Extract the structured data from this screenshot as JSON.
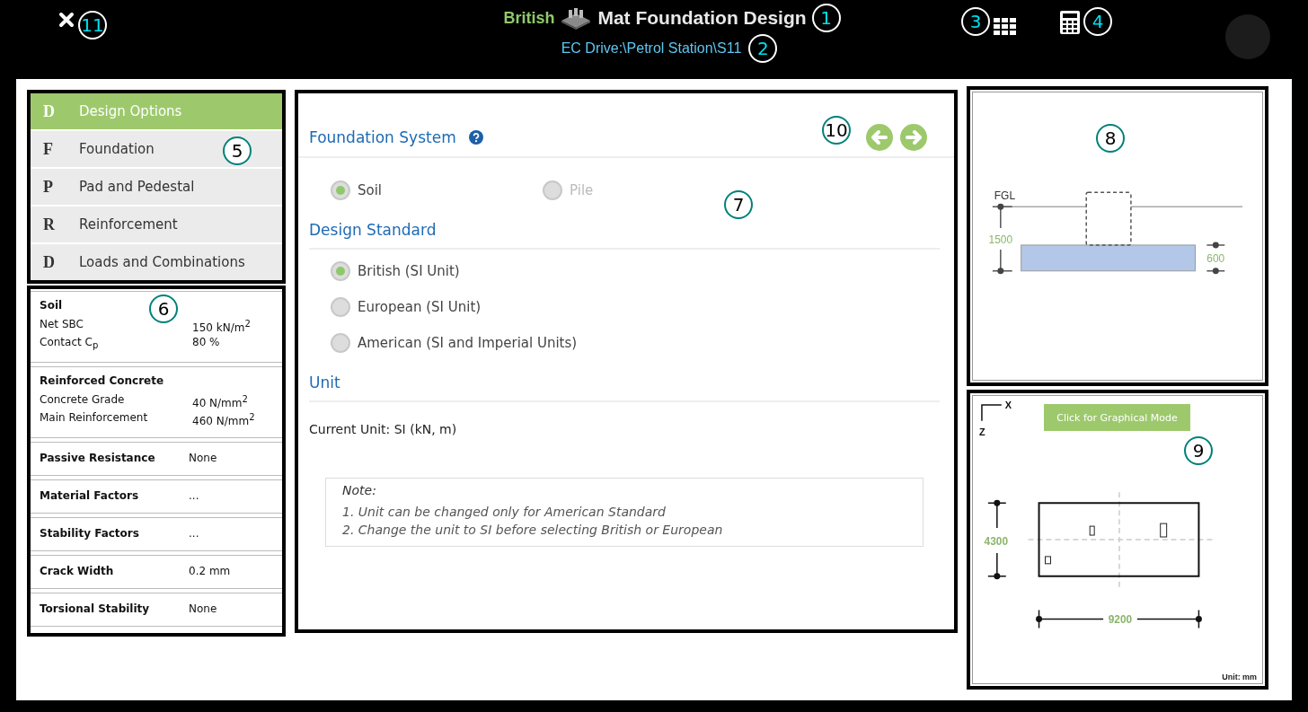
{
  "header": {
    "close_callout": "11",
    "region": "British",
    "title": "Mat Foundation Design",
    "title_callout": "1",
    "path": "EC Drive:\\Petrol Station\\S11",
    "path_callout": "2",
    "grid_callout": "3",
    "calculator_callout": "4"
  },
  "nav": {
    "callout": "5",
    "items": [
      {
        "initial": "D",
        "label": "Design Options",
        "selected": true
      },
      {
        "initial": "F",
        "label": "Foundation",
        "selected": false
      },
      {
        "initial": "P",
        "label": "Pad and Pedestal",
        "selected": false
      },
      {
        "initial": "R",
        "label": "Reinforcement",
        "selected": false
      },
      {
        "initial": "D",
        "label": "Loads and Combinations",
        "selected": false
      }
    ]
  },
  "summary": {
    "callout": "6",
    "sections": [
      {
        "kind": "group",
        "title": "Soil",
        "rows": [
          {
            "label": "Net SBC",
            "value": "150 kN/m$^{2}$"
          },
          {
            "label": "Contact C$_{p}$",
            "value": "80 %"
          }
        ]
      },
      {
        "kind": "group",
        "title": "Reinforced Concrete",
        "rows": [
          {
            "label": "Concrete Grade",
            "value": "40 N/mm$^{2}$"
          },
          {
            "label": "Main Reinforcement",
            "value": "460 N/mm$^{2}$"
          }
        ]
      },
      {
        "kind": "single",
        "title": "Passive Resistance",
        "value": "None"
      },
      {
        "kind": "single",
        "title": "Material Factors",
        "value": "..."
      },
      {
        "kind": "single",
        "title": "Stability Factors",
        "value": "..."
      },
      {
        "kind": "single",
        "title": "Crack Width",
        "value": "0.2 mm"
      },
      {
        "kind": "single",
        "title": "Torsional Stability",
        "value": "None"
      }
    ]
  },
  "main": {
    "callout": "7",
    "nav_callout": "10",
    "foundation_system": {
      "title": "Foundation System",
      "options": [
        {
          "label": "Soil",
          "selected": true,
          "disabled": false
        },
        {
          "label": "Pile",
          "selected": false,
          "disabled": true
        }
      ]
    },
    "design_standard": {
      "title": "Design Standard",
      "options": [
        {
          "label": "British (SI Unit)",
          "selected": true,
          "disabled": false
        },
        {
          "label": "European (SI Unit)",
          "selected": false,
          "disabled": false
        },
        {
          "label": "American (SI and Imperial Units)",
          "selected": false,
          "disabled": false
        }
      ]
    },
    "unit": {
      "title": "Unit",
      "current": "Current Unit: SI (kN, m)"
    },
    "note": {
      "title": "Note:",
      "lines": [
        "1. Unit can be changed only for American Standard",
        "2. Change the unit to SI before selecting British or European"
      ]
    }
  },
  "elevation": {
    "callout": "8",
    "level_label": "FGL",
    "depth": "1500",
    "thickness": "600"
  },
  "plan": {
    "callout": "9",
    "axis_x": "X",
    "axis_z": "Z",
    "button": "Click for Graphical Mode",
    "width_dim": "4300",
    "length_dim": "9200",
    "unit": "Unit: mm"
  }
}
